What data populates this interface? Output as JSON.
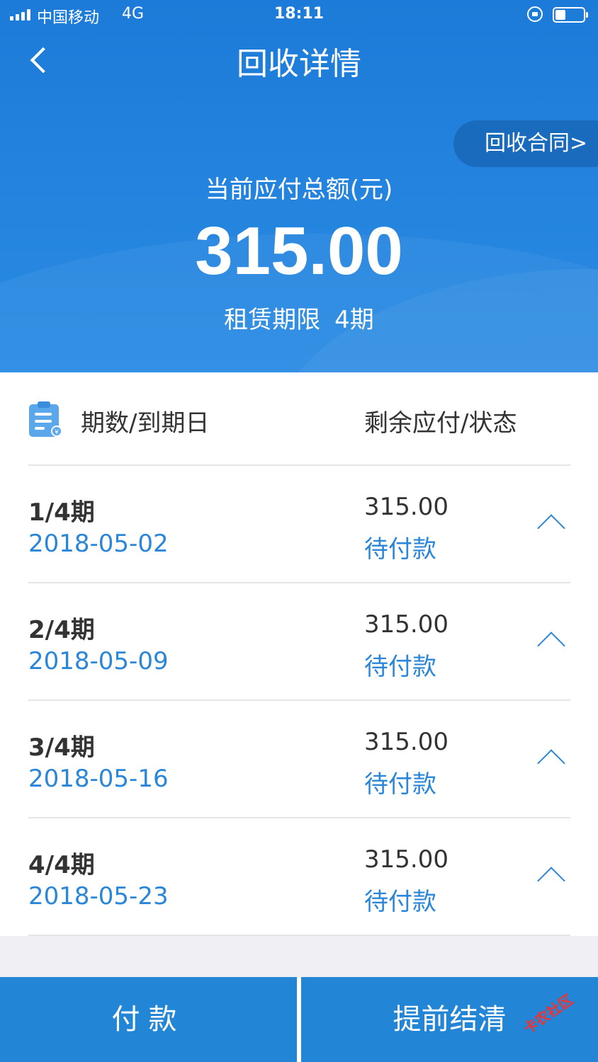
{
  "status_bar": {
    "carrier": "中国移动",
    "network": "4G",
    "time": "18:11"
  },
  "nav": {
    "title": "回收详情"
  },
  "header": {
    "contract_link": "回收合同>",
    "amount_label": "当前应付总额(元)",
    "amount_value": "315.00",
    "term_label": "租赁期限",
    "term_value": "4期"
  },
  "list": {
    "col_left": "期数/到期日",
    "col_right": "剩余应付/状态",
    "rows": [
      {
        "period": "1/4期",
        "due_date": "2018-05-02",
        "remaining": "315.00",
        "status": "待付款"
      },
      {
        "period": "2/4期",
        "due_date": "2018-05-09",
        "remaining": "315.00",
        "status": "待付款"
      },
      {
        "period": "3/4期",
        "due_date": "2018-05-16",
        "remaining": "315.00",
        "status": "待付款"
      },
      {
        "period": "4/4期",
        "due_date": "2018-05-23",
        "remaining": "315.00",
        "status": "待付款"
      }
    ]
  },
  "actions": {
    "pay_label": "付款",
    "settle_label": "提前结清"
  },
  "watermark": "卡农社区",
  "colors": {
    "primary": "#2385d6",
    "link": "#2a86d8",
    "text": "#333333"
  }
}
